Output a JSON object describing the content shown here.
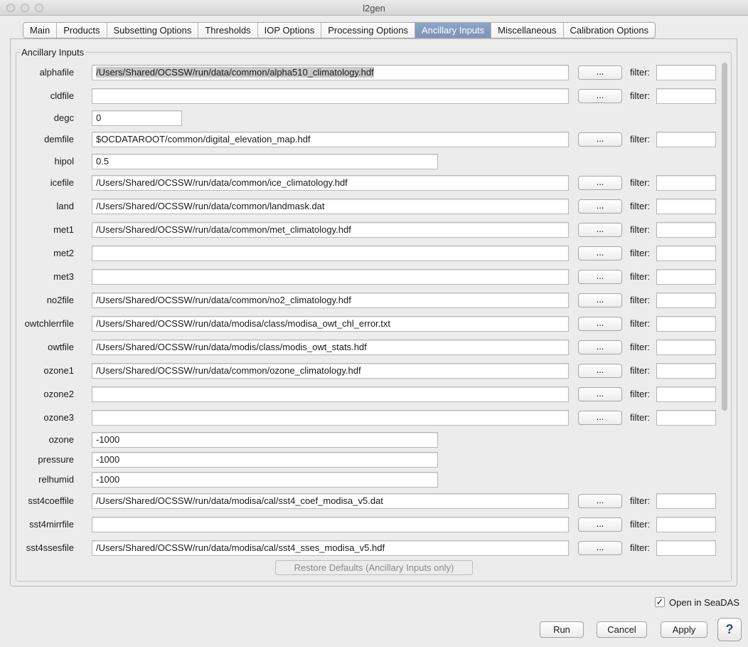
{
  "window": {
    "title": "l2gen"
  },
  "tabs": [
    {
      "label": "Main"
    },
    {
      "label": "Products"
    },
    {
      "label": "Subsetting Options"
    },
    {
      "label": "Thresholds"
    },
    {
      "label": "IOP Options"
    },
    {
      "label": "Processing Options"
    },
    {
      "label": "Ancillary Inputs"
    },
    {
      "label": "Miscellaneous"
    },
    {
      "label": "Calibration Options"
    }
  ],
  "active_tab": "Ancillary Inputs",
  "section": {
    "title": "Ancillary Inputs"
  },
  "browse_label": "...",
  "filter_label": "filter:",
  "fields": [
    {
      "label": "alphafile",
      "value": "/Users/Shared/OCSSW/run/data/common/alpha510_climatology.hdf",
      "kind": "file"
    },
    {
      "label": "cldfile",
      "value": "",
      "kind": "file"
    },
    {
      "label": "degc",
      "value": "0",
      "kind": "short"
    },
    {
      "label": "demfile",
      "value": "$OCDATAROOT/common/digital_elevation_map.hdf",
      "kind": "file"
    },
    {
      "label": "hipol",
      "value": "0.5",
      "kind": "medium"
    },
    {
      "label": "icefile",
      "value": "/Users/Shared/OCSSW/run/data/common/ice_climatology.hdf",
      "kind": "file"
    },
    {
      "label": "land",
      "value": "/Users/Shared/OCSSW/run/data/common/landmask.dat",
      "kind": "file"
    },
    {
      "label": "met1",
      "value": "/Users/Shared/OCSSW/run/data/common/met_climatology.hdf",
      "kind": "file"
    },
    {
      "label": "met2",
      "value": "",
      "kind": "file"
    },
    {
      "label": "met3",
      "value": "",
      "kind": "file"
    },
    {
      "label": "no2file",
      "value": "/Users/Shared/OCSSW/run/data/common/no2_climatology.hdf",
      "kind": "file"
    },
    {
      "label": "owtchlerrfile",
      "value": "/Users/Shared/OCSSW/run/data/modisa/class/modisa_owt_chl_error.txt",
      "kind": "file"
    },
    {
      "label": "owtfile",
      "value": "/Users/Shared/OCSSW/run/data/modis/class/modis_owt_stats.hdf",
      "kind": "file"
    },
    {
      "label": "ozone1",
      "value": "/Users/Shared/OCSSW/run/data/common/ozone_climatology.hdf",
      "kind": "file"
    },
    {
      "label": "ozone2",
      "value": "",
      "kind": "file"
    },
    {
      "label": "ozone3",
      "value": "",
      "kind": "file"
    },
    {
      "label": "ozone",
      "value": "-1000",
      "kind": "medium"
    },
    {
      "label": "pressure",
      "value": "-1000",
      "kind": "medium"
    },
    {
      "label": "relhumid",
      "value": "-1000",
      "kind": "medium"
    },
    {
      "label": "sst4coeffile",
      "value": "/Users/Shared/OCSSW/run/data/modisa/cal/sst4_coef_modisa_v5.dat",
      "kind": "file"
    },
    {
      "label": "sst4mirrfile",
      "value": "",
      "kind": "file"
    },
    {
      "label": "sst4ssesfile",
      "value": "/Users/Shared/OCSSW/run/data/modisa/cal/sst4_sses_modisa_v5.hdf",
      "kind": "file"
    }
  ],
  "restore_button": "Restore Defaults (Ancillary Inputs only)",
  "open_in_seadas": {
    "label": "Open in SeaDAS",
    "checked": true,
    "mark": "✓"
  },
  "buttons": {
    "run": "Run",
    "cancel": "Cancel",
    "apply": "Apply",
    "help": "?"
  }
}
